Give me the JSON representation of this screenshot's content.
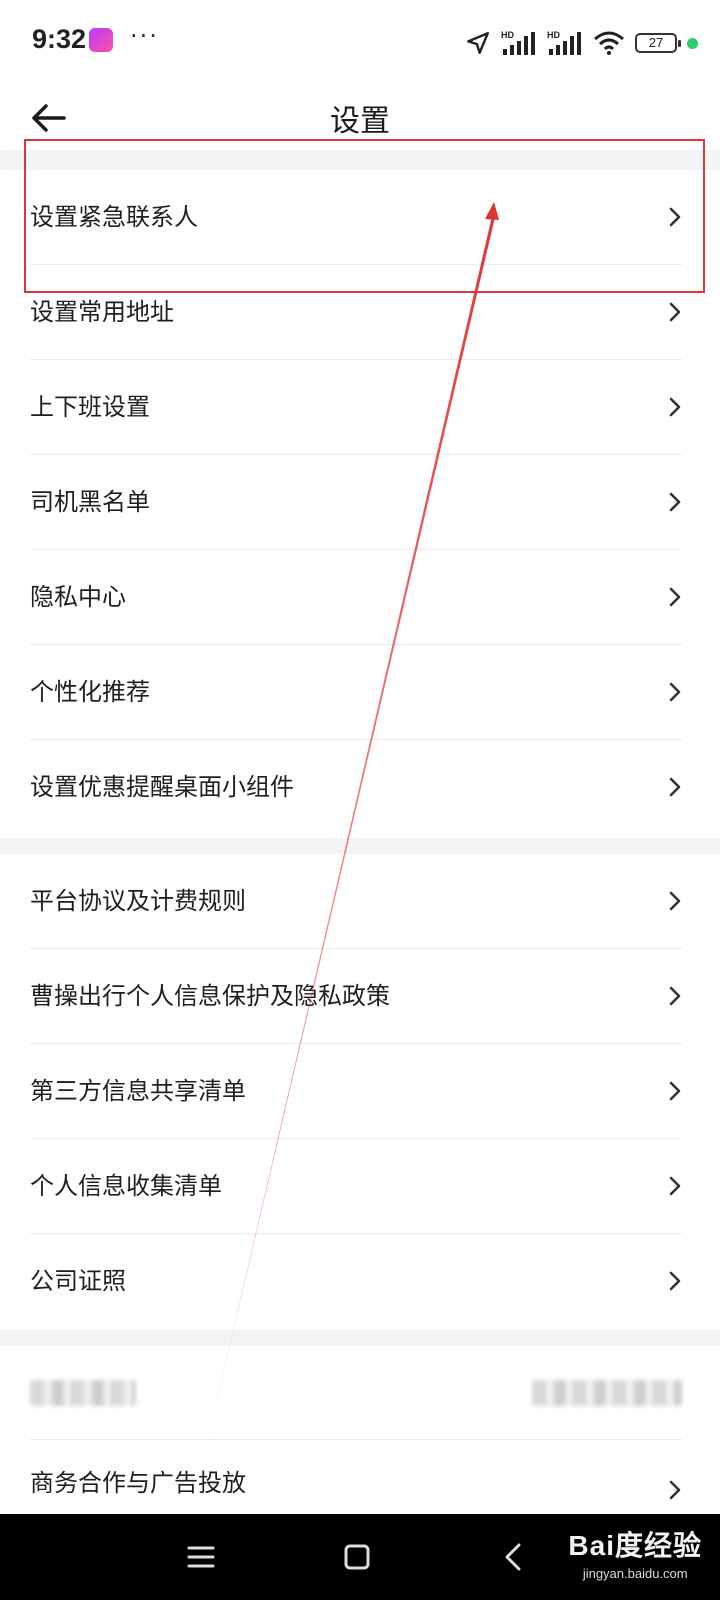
{
  "status_bar": {
    "time": "9:32",
    "dots": "···",
    "battery": "27",
    "network_1": "HD",
    "network_2": "HD"
  },
  "header": {
    "title": "设置"
  },
  "groups": [
    {
      "items": [
        {
          "label": "设置紧急联系人"
        },
        {
          "label": "设置常用地址"
        },
        {
          "label": "上下班设置"
        },
        {
          "label": "司机黑名单"
        },
        {
          "label": "隐私中心"
        },
        {
          "label": "个性化推荐"
        },
        {
          "label": "设置优惠提醒桌面小组件"
        }
      ]
    },
    {
      "items": [
        {
          "label": "平台协议及计费规则"
        },
        {
          "label": "曹操出行个人信息保护及隐私政策"
        },
        {
          "label": "第三方信息共享清单"
        },
        {
          "label": "个人信息收集清单"
        },
        {
          "label": "公司证照"
        }
      ]
    },
    {
      "items": [
        {
          "label": "商务合作与广告投放"
        }
      ]
    }
  ],
  "watermark": {
    "brand": "Bai度经验",
    "url": "jingyan.baidu.com"
  },
  "colors": {
    "annotation": "#e03434",
    "section_gap": "#f4f4f6"
  }
}
